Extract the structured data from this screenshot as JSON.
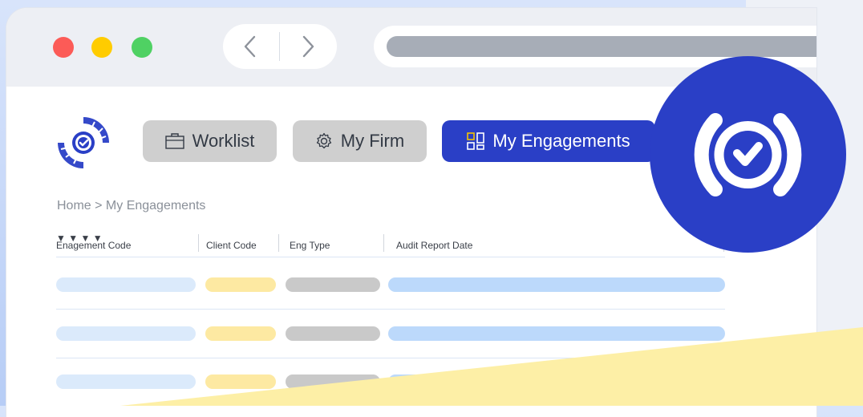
{
  "browser": {
    "traffic_lights": [
      "close",
      "minimize",
      "maximize"
    ],
    "back_icon": "chevron-left-icon",
    "forward_icon": "chevron-right-icon"
  },
  "tabs": [
    {
      "label": "Worklist",
      "icon": "briefcase-icon"
    },
    {
      "label": "My Firm",
      "icon": "gear-icon"
    },
    {
      "label": "My Engagements",
      "icon": "grid-icon",
      "active": true
    }
  ],
  "breadcrumb": "Home > My Engagements",
  "table": {
    "columns": [
      {
        "label": "Enagement Code",
        "sort": "▼"
      },
      {
        "label": "Client Code",
        "sort": "▼"
      },
      {
        "label": "Eng Type",
        "sort": "▼"
      },
      {
        "label": "Audit Report Date",
        "sort": "▼"
      }
    ],
    "placeholder_rows": 3
  },
  "colors": {
    "brand": "#2a3fc6",
    "row_col1": "#dbeafb",
    "row_col2": "#fde9a2",
    "row_col3": "#c9c9c9",
    "row_col4": "#bcd9fb",
    "accent_yellow": "#fdefa6"
  }
}
